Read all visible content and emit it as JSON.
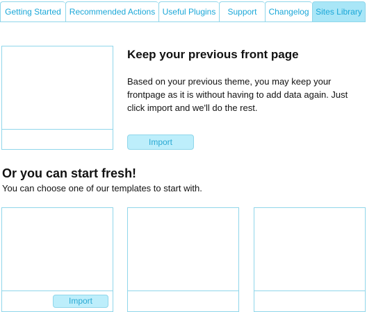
{
  "tabs": [
    {
      "label": "Getting Started"
    },
    {
      "label": "Recommended Actions"
    },
    {
      "label": "Useful Plugins"
    },
    {
      "label": "Support"
    },
    {
      "label": "Changelog"
    },
    {
      "label": "Sites Library",
      "active": true
    }
  ],
  "featured": {
    "title": "Keep your previous front page",
    "description": "Based on your previous theme, you may keep your frontpage as it is without having to add data again. Just click import and we'll do the rest.",
    "import_label": "Import"
  },
  "fresh": {
    "title": "Or you can start fresh!",
    "subtitle": "You can choose one of our templates to start with.",
    "templates": [
      {
        "import_label": "Import"
      },
      {},
      {}
    ]
  },
  "colors": {
    "accent": "#1aa7d8",
    "border": "#8fd6ea",
    "active_tab_bg": "#a9e6f7",
    "button_bg": "#bdeefb"
  }
}
